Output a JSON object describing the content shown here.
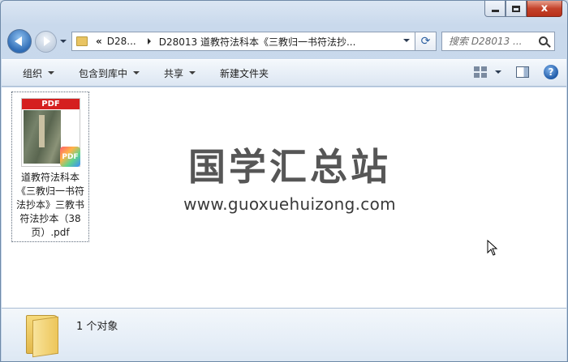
{
  "window": {
    "caption": {
      "close_label": "x"
    }
  },
  "nav": {
    "breadcrumb": [
      "D28...",
      "D28013 道教符法科本《三教归一书符法抄..."
    ],
    "overflow_chevron": "«",
    "refresh_glyph": "⟳",
    "search_placeholder": "搜索 D28013 ..."
  },
  "toolbar": {
    "organize": "组织",
    "include_in_library": "包含到库中",
    "share": "共享",
    "new_folder": "新建文件夹",
    "help": "?"
  },
  "content": {
    "files": [
      {
        "name": "道教符法科本《三教归一书符法抄本》三教书符法抄本（38页）.pdf",
        "thumb_banner": "PDF",
        "badge": "PDF",
        "icon": "pdf-file-icon"
      }
    ],
    "watermark": {
      "title": "国学汇总站",
      "url": "www.guoxuehuizong.com"
    }
  },
  "details": {
    "count_text": "1 个对象",
    "icon": "folder-icon"
  },
  "colors": {
    "accent": "#2f6cb5",
    "close": "#c4432b",
    "pdf_red": "#d51f1f"
  }
}
